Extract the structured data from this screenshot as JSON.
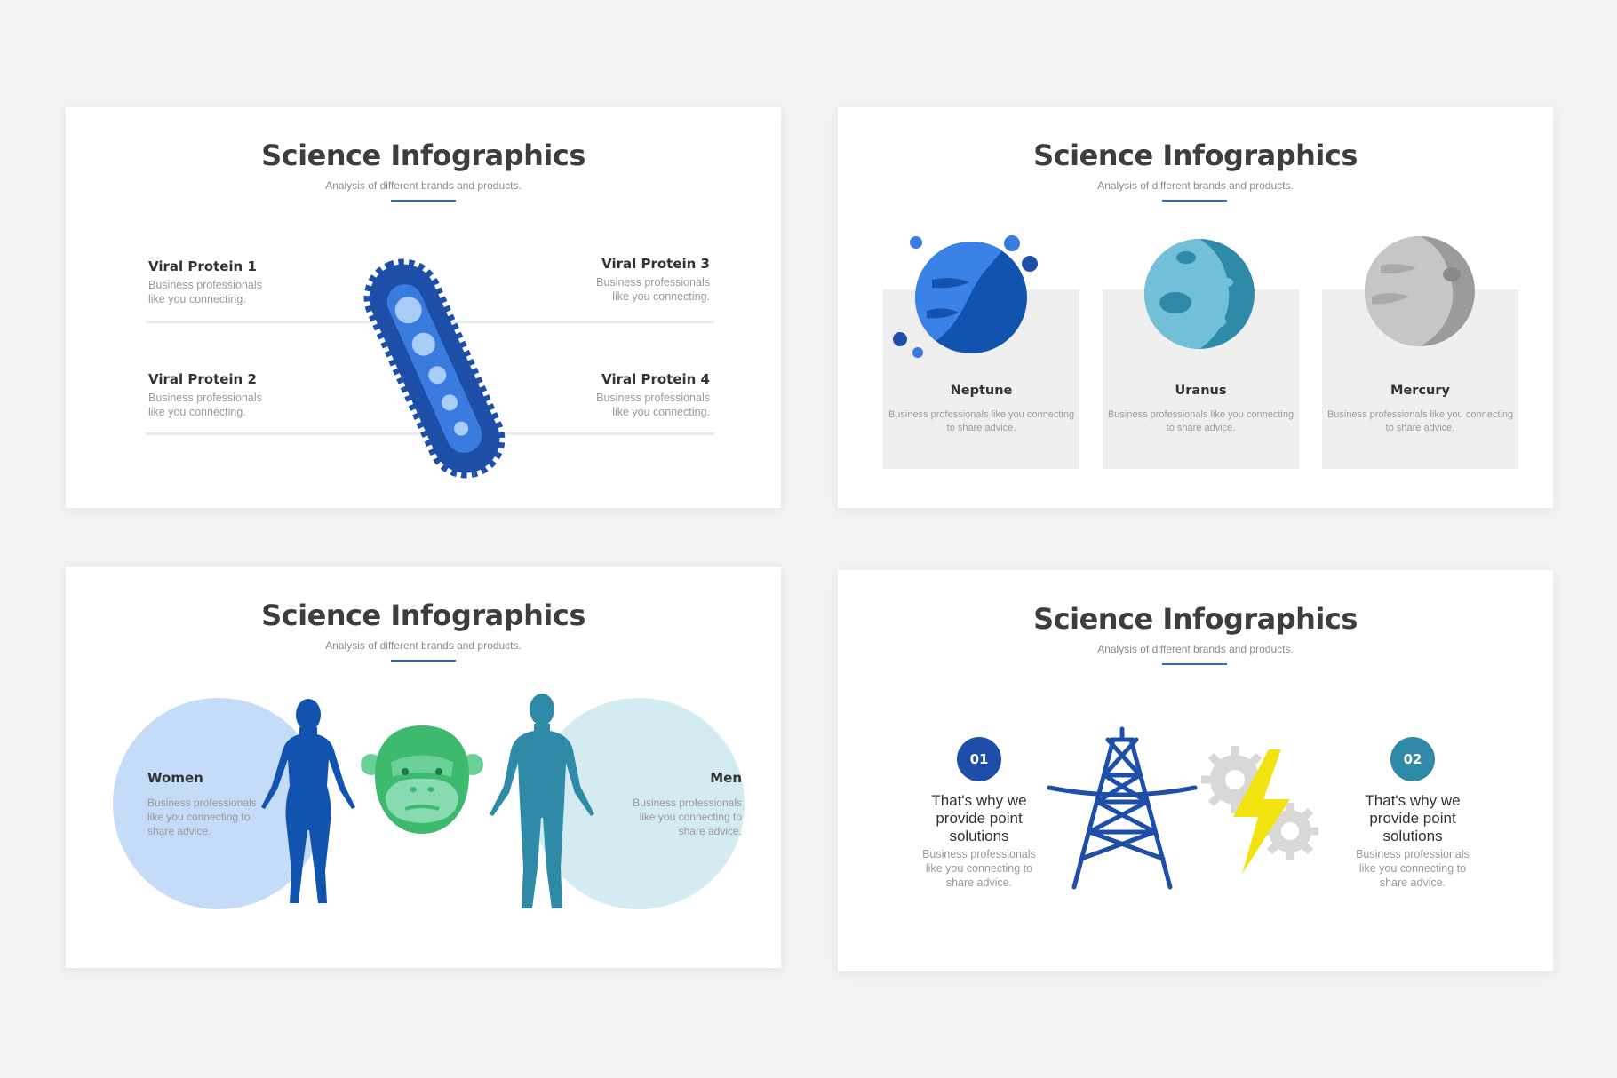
{
  "slides": [
    {
      "title": "Science Infographics",
      "subtitle": "Analysis of different brands and products.",
      "items": [
        {
          "label": "Viral Protein 1",
          "desc": "Business professionals like you connecting."
        },
        {
          "label": "Viral Protein 3",
          "desc": "Business professionals like you connecting."
        },
        {
          "label": "Viral Protein 2",
          "desc": "Business professionals like you connecting."
        },
        {
          "label": "Viral Protein 4",
          "desc": "Business professionals like you connecting."
        }
      ]
    },
    {
      "title": "Science Infographics",
      "subtitle": "Analysis of different brands and products.",
      "planets": [
        {
          "label": "Neptune",
          "desc": "Business professionals like you connecting to share advice.",
          "color": "#3a7be0"
        },
        {
          "label": "Uranus",
          "desc": "Business professionals like you connecting to share advice.",
          "color": "#73bfd9"
        },
        {
          "label": "Mercury",
          "desc": "Business professionals like you connecting to share advice.",
          "color": "#bdbdbd"
        }
      ]
    },
    {
      "title": "Science Infographics",
      "subtitle": "Analysis of different brands and products.",
      "women": {
        "label": "Women",
        "desc": "Business professionals like you connecting to share advice.",
        "color": "#c5dcf8"
      },
      "men": {
        "label": "Men",
        "desc": "Business professionals like you connecting to share advice.",
        "color": "#d4ebf2"
      }
    },
    {
      "title": "Science Infographics",
      "subtitle": "Analysis of different brands and products.",
      "points": [
        {
          "number": "01",
          "heading": "That's why we provide point solutions",
          "desc": "Business professionals like you connecting to share advice.",
          "color": "#1e4fa8"
        },
        {
          "number": "02",
          "heading": "That's why we provide point solutions",
          "desc": "Business professionals like you connecting to share advice.",
          "color": "#2e8aa6"
        }
      ]
    }
  ],
  "colors": {
    "accent": "#2a6ac8",
    "background": "#f2f2f3"
  }
}
